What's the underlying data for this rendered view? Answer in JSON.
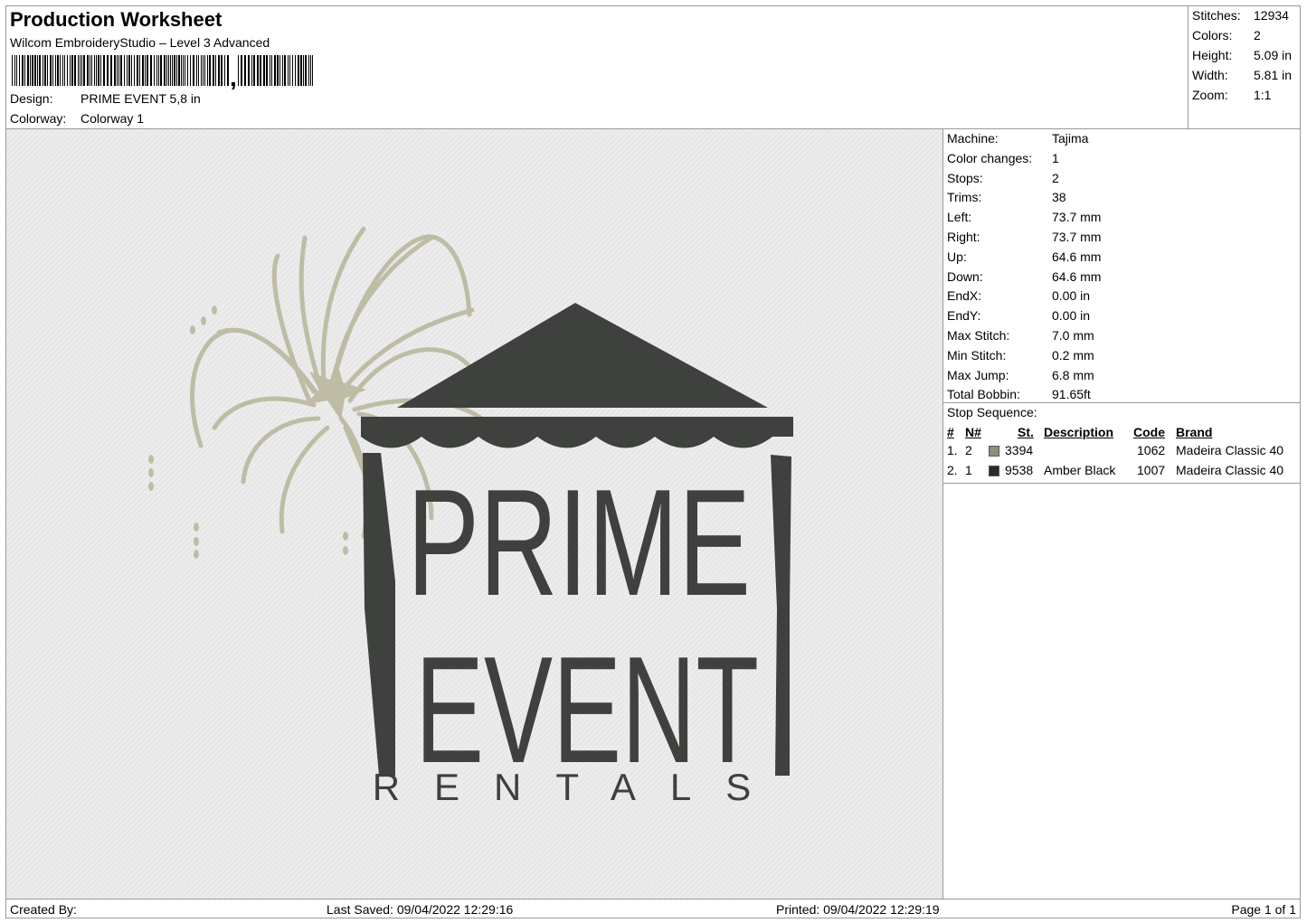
{
  "header": {
    "title": "Production Worksheet",
    "software": "Wilcom EmbroideryStudio – Level 3 Advanced",
    "design_label": "Design:",
    "design_value": "PRIME EVENT 5,8 in",
    "colorway_label": "Colorway:",
    "colorway_value": "Colorway 1"
  },
  "stats": [
    {
      "label": "Stitches:",
      "value": "12934"
    },
    {
      "label": "Colors:",
      "value": "2"
    },
    {
      "label": "Height:",
      "value": "5.09 in"
    },
    {
      "label": "Width:",
      "value": "5.81 in"
    },
    {
      "label": "Zoom:",
      "value": "1:1"
    }
  ],
  "machine_info": [
    {
      "label": "Machine:",
      "value": "Tajima"
    },
    {
      "label": "Color changes:",
      "value": "1"
    },
    {
      "label": "Stops:",
      "value": "2"
    },
    {
      "label": "Trims:",
      "value": "38"
    },
    {
      "label": "Left:",
      "value": "73.7 mm"
    },
    {
      "label": "Right:",
      "value": "73.7 mm"
    },
    {
      "label": "Up:",
      "value": "64.6 mm"
    },
    {
      "label": "Down:",
      "value": "64.6 mm"
    },
    {
      "label": "EndX:",
      "value": "0.00 in"
    },
    {
      "label": "EndY:",
      "value": "0.00 in"
    },
    {
      "label": "Max Stitch:",
      "value": "7.0 mm"
    },
    {
      "label": "Min Stitch:",
      "value": "0.2 mm"
    },
    {
      "label": "Max Jump:",
      "value": "6.8 mm"
    },
    {
      "label": "Total Bobbin:",
      "value": "91.65ft"
    }
  ],
  "stop_sequence": {
    "title": "Stop Sequence:",
    "columns": [
      "#",
      "N#",
      "St.",
      "Description",
      "Code",
      "Brand"
    ],
    "rows": [
      {
        "num": "1.",
        "needle": "2",
        "color": "#8f8b7e",
        "stitches": "3394",
        "description": "",
        "code": "1062",
        "brand": "Madeira Classic 40"
      },
      {
        "num": "2.",
        "needle": "1",
        "color": "#2b2b2b",
        "stitches": "9538",
        "description": "Amber Black",
        "code": "1007",
        "brand": "Madeira Classic 40"
      }
    ]
  },
  "design_artwork": {
    "line1": "PRIME",
    "line2": "EVENT",
    "line3": "RENTALS",
    "thread_dark": "#3e413d",
    "thread_light": "#bfbca6"
  },
  "footer": {
    "created_by": "Created By:",
    "last_saved": "Last Saved: 09/04/2022 12:29:16",
    "printed": "Printed: 09/04/2022 12:29:19",
    "page": "Page 1 of 1"
  }
}
